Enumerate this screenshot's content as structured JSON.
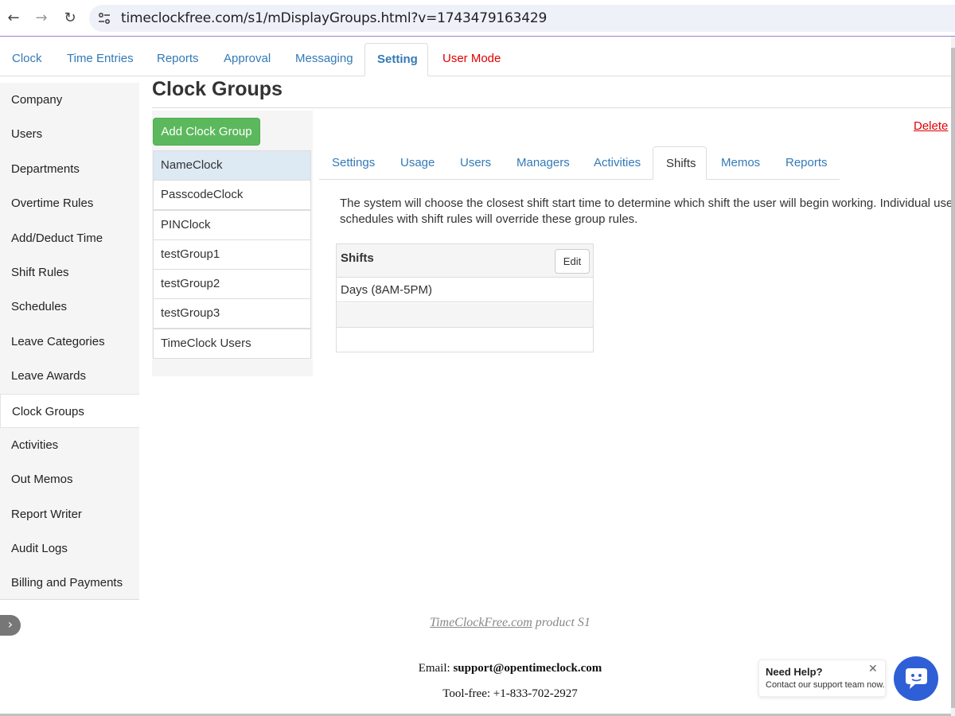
{
  "browser": {
    "url": "timeclockfree.com/s1/mDisplayGroups.html?v=1743479163429"
  },
  "top_tabs": [
    {
      "label": "Clock"
    },
    {
      "label": "Time Entries"
    },
    {
      "label": "Reports"
    },
    {
      "label": "Approval"
    },
    {
      "label": "Messaging"
    },
    {
      "label": "Setting"
    },
    {
      "label": "User Mode"
    }
  ],
  "sidebar": {
    "items": [
      {
        "label": "Company"
      },
      {
        "label": "Users"
      },
      {
        "label": "Departments"
      },
      {
        "label": "Overtime Rules"
      },
      {
        "label": "Add/Deduct Time"
      },
      {
        "label": "Shift Rules"
      },
      {
        "label": "Schedules"
      },
      {
        "label": "Leave Categories"
      },
      {
        "label": "Leave Awards"
      },
      {
        "label": "Clock Groups"
      },
      {
        "label": "Activities"
      },
      {
        "label": "Out Memos"
      },
      {
        "label": "Report Writer"
      },
      {
        "label": "Audit Logs"
      },
      {
        "label": "Billing and Payments"
      }
    ],
    "toggle_glyph": "›"
  },
  "page": {
    "title": "Clock Groups",
    "add_button": "Add Clock Group",
    "delete_link": "Delete"
  },
  "groups": [
    {
      "label": "NameClock"
    },
    {
      "label": "PasscodeClock"
    },
    {
      "label": "PINClock"
    },
    {
      "label": "testGroup1"
    },
    {
      "label": "testGroup2"
    },
    {
      "label": "testGroup3"
    },
    {
      "label": "TimeClock Users"
    }
  ],
  "detail_tabs": [
    {
      "label": "Settings"
    },
    {
      "label": "Usage"
    },
    {
      "label": "Users"
    },
    {
      "label": "Managers"
    },
    {
      "label": "Activities"
    },
    {
      "label": "Shifts"
    },
    {
      "label": "Memos"
    },
    {
      "label": "Reports"
    }
  ],
  "shifts": {
    "description_line1": "The system will choose the closest shift start time to determine which shift the user will begin working. Individual users' shift",
    "description_line2": "schedules with shift rules will override these group rules.",
    "table_header": "Shifts",
    "edit_button": "Edit",
    "rows": [
      {
        "label": "Days (8AM-5PM)"
      },
      {
        "label": ""
      },
      {
        "label": ""
      }
    ]
  },
  "footer": {
    "product_link": "TimeClockFree.com",
    "product_suffix": "product S1",
    "email_label": "Email:",
    "email_value": "support@opentimeclock.com",
    "phone": "Tool-free: +1-833-702-2927"
  },
  "help_widget": {
    "title": "Need Help?",
    "subtitle": "Contact our support team now.",
    "close_glyph": "✕"
  },
  "colors": {
    "link_blue": "#337ab7",
    "alert_red": "#e00000",
    "add_green": "#5cb85c",
    "selected_row": "#dde9f3",
    "chat_blue": "#2f5fd6"
  }
}
